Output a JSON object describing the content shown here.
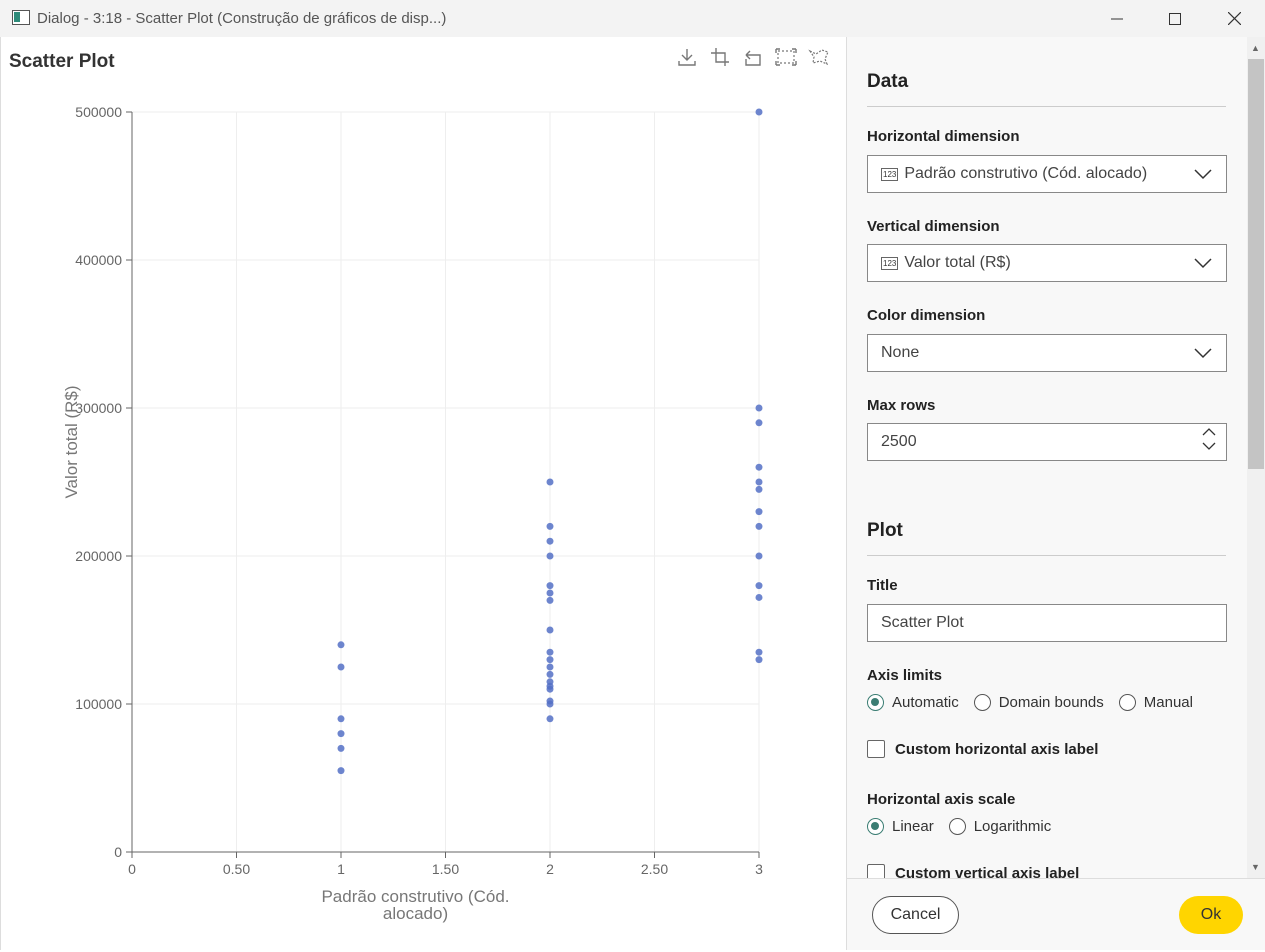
{
  "window": {
    "title": "Dialog - 3:18 - Scatter Plot (Construção de gráficos de disp...)",
    "minimize_label": "—",
    "maximize_label": "☐",
    "close_label": "✕"
  },
  "chart_panel": {
    "title": "Scatter Plot",
    "toolbar": [
      "download-icon",
      "crop-icon",
      "undo-icon",
      "box-select-icon",
      "lasso-icon"
    ]
  },
  "chart_data": {
    "type": "scatter",
    "title": "Scatter Plot",
    "xlabel": "Padrão construtivo (Cód. alocado)",
    "xlabel_lines": [
      "Padrão construtivo (Cód.",
      "alocado)"
    ],
    "ylabel": "Valor  total (R$)",
    "xlim": [
      0,
      3
    ],
    "ylim": [
      0,
      500000
    ],
    "x_ticks": [
      0,
      0.5,
      1,
      1.5,
      2,
      2.5,
      3
    ],
    "x_tick_labels": [
      "0",
      "0.50",
      "1",
      "1.50",
      "2",
      "2.50",
      "3"
    ],
    "y_ticks": [
      0,
      100000,
      200000,
      300000,
      400000,
      500000
    ],
    "y_tick_labels": [
      "0",
      "100000",
      "200000",
      "300000",
      "400000",
      "500000"
    ],
    "grid": true,
    "point_color": "#5470c6",
    "points": [
      [
        1,
        140000
      ],
      [
        1,
        125000
      ],
      [
        1,
        90000
      ],
      [
        1,
        80000
      ],
      [
        1,
        70000
      ],
      [
        1,
        55000
      ],
      [
        2,
        250000
      ],
      [
        2,
        220000
      ],
      [
        2,
        210000
      ],
      [
        2,
        200000
      ],
      [
        2,
        180000
      ],
      [
        2,
        175000
      ],
      [
        2,
        170000
      ],
      [
        2,
        150000
      ],
      [
        2,
        135000
      ],
      [
        2,
        130000
      ],
      [
        2,
        125000
      ],
      [
        2,
        120000
      ],
      [
        2,
        115000
      ],
      [
        2,
        112000
      ],
      [
        2,
        110000
      ],
      [
        2,
        102000
      ],
      [
        2,
        100000
      ],
      [
        2,
        90000
      ],
      [
        3,
        500000
      ],
      [
        3,
        300000
      ],
      [
        3,
        290000
      ],
      [
        3,
        260000
      ],
      [
        3,
        250000
      ],
      [
        3,
        245000
      ],
      [
        3,
        230000
      ],
      [
        3,
        220000
      ],
      [
        3,
        200000
      ],
      [
        3,
        180000
      ],
      [
        3,
        172000
      ],
      [
        3,
        135000
      ],
      [
        3,
        130000
      ]
    ]
  },
  "settings": {
    "data_heading": "Data",
    "horizontal_dimension": {
      "label": "Horizontal dimension",
      "value": "Padrão construtivo (Cód. alocado)",
      "badge": "123"
    },
    "vertical_dimension": {
      "label": "Vertical dimension",
      "value": "Valor total (R$)",
      "badge": "123"
    },
    "color_dimension": {
      "label": "Color dimension",
      "value": "None"
    },
    "max_rows": {
      "label": "Max rows",
      "value": "2500"
    },
    "plot_heading": "Plot",
    "title_field": {
      "label": "Title",
      "value": "Scatter Plot"
    },
    "axis_limits": {
      "label": "Axis limits",
      "options": [
        "Automatic",
        "Domain bounds",
        "Manual"
      ],
      "selected": "Automatic"
    },
    "custom_h_label": "Custom horizontal axis label",
    "h_axis_scale": {
      "label": "Horizontal axis scale",
      "options": [
        "Linear",
        "Logarithmic"
      ],
      "selected": "Linear"
    },
    "custom_v_label": "Custom vertical axis label"
  },
  "footer": {
    "cancel_label": "Cancel",
    "ok_label": "Ok",
    "ok_color": "#ffd500"
  }
}
